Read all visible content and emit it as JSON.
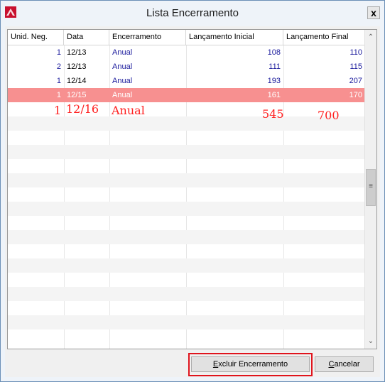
{
  "window": {
    "title": "Lista Encerramento",
    "close_label": "x",
    "accent": "#e0141d"
  },
  "table": {
    "columns": [
      "Unid. Neg.",
      "Data",
      "Encerramento",
      "Lançamento Inicial",
      "Lançamento Final"
    ],
    "rows": [
      {
        "unid": "1",
        "data": "12/13",
        "enc": "Anual",
        "ini": "108",
        "fim": "110"
      },
      {
        "unid": "2",
        "data": "12/13",
        "enc": "Anual",
        "ini": "111",
        "fim": "115"
      },
      {
        "unid": "1",
        "data": "12/14",
        "enc": "Anual",
        "ini": "193",
        "fim": "207"
      },
      {
        "unid": "1",
        "data": "12/15",
        "enc": "Anual",
        "ini": "161",
        "fim": "170",
        "selected": true
      }
    ],
    "handwritten": {
      "unid": "1",
      "data": "12/16",
      "enc": "Anual",
      "ini": "545",
      "fim": "700"
    }
  },
  "buttons": {
    "excluir_mnemonic": "E",
    "excluir_rest": "xcluir Encerramento",
    "cancelar_mnemonic": "C",
    "cancelar_rest": "ancelar"
  }
}
